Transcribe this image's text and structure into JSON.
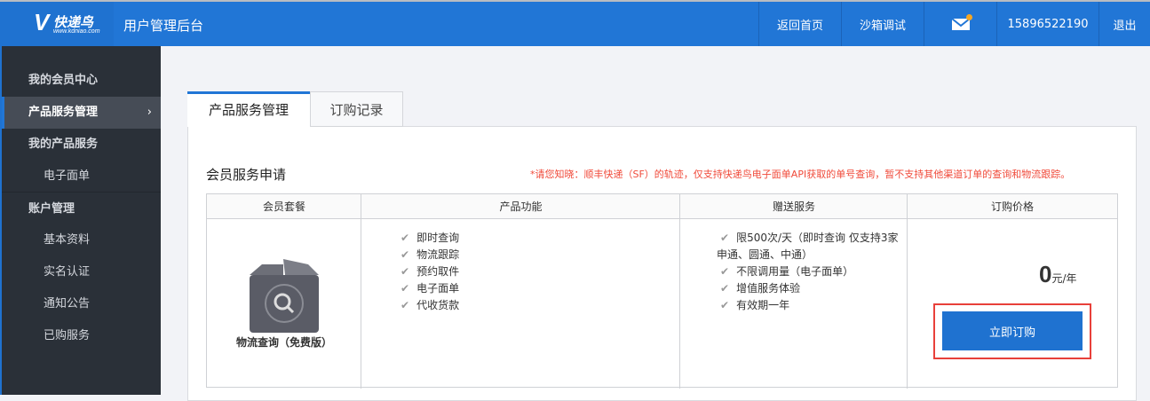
{
  "header": {
    "logo_text": "快递鸟",
    "logo_url": "www.kdniao.com",
    "app_title": "用户管理后台",
    "nav": [
      "返回首页",
      "沙箱调试"
    ],
    "phone": "15896522190",
    "logout": "退出"
  },
  "sidebar": {
    "items": [
      {
        "label": "我的会员中心"
      },
      {
        "label": "产品服务管理",
        "chevron": "›"
      },
      {
        "label": "我的产品服务"
      },
      {
        "label": "电子面单"
      },
      {
        "label": "账户管理"
      },
      {
        "label": "基本资料"
      },
      {
        "label": "实名认证"
      },
      {
        "label": "通知公告"
      },
      {
        "label": "已购服务"
      }
    ]
  },
  "tabs": [
    "产品服务管理",
    "订购记录"
  ],
  "section": {
    "title": "会员服务申请",
    "notice": "*请您知晓：顺丰快递（SF）的轨迹，仅支持快递鸟电子面单API获取的单号查询，暂不支持其他渠道订单的查询和物流跟踪。"
  },
  "table": {
    "headers": [
      "会员套餐",
      "产品功能",
      "赠送服务",
      "订购价格"
    ],
    "row": {
      "package": "物流查询（免费版）",
      "features": [
        "即时查询",
        "物流跟踪",
        "预约取件",
        "电子面单",
        "代收货款"
      ],
      "gifts": [
        "限500次/天（即时查询 仅支持3家申通、圆通、中通）",
        "不限调用量（电子面单）",
        "增值服务体验",
        "有效期一年"
      ],
      "price": "0",
      "unit": "元/年",
      "check": "✔",
      "buy_label": "立即订购"
    }
  },
  "colors": {
    "primary": "#2176d6",
    "sidebar": "#2a3038",
    "notice": "#f04a3a"
  }
}
